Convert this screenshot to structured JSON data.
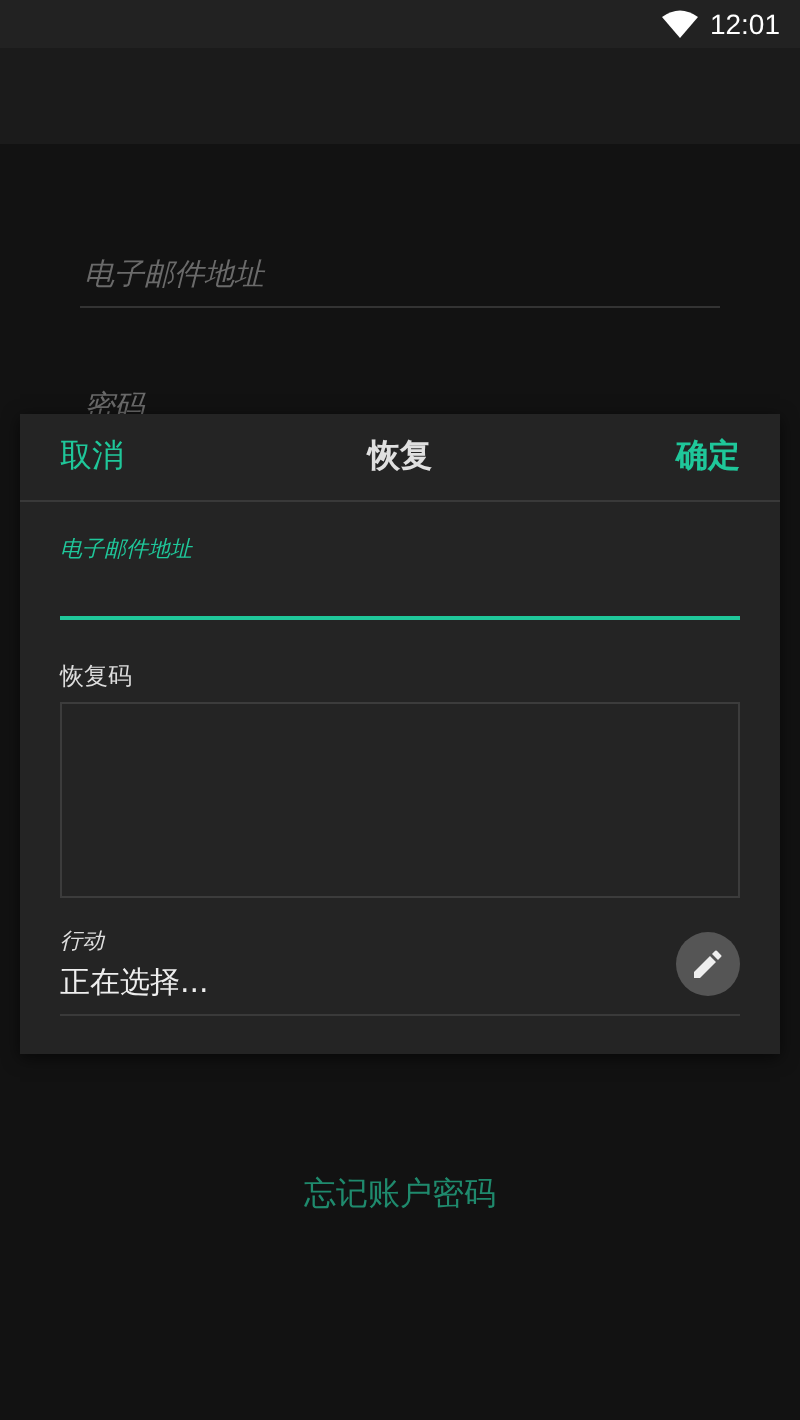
{
  "status_bar": {
    "time": "12:01"
  },
  "login_form": {
    "email": {
      "placeholder": "电子邮件地址"
    },
    "password": {
      "placeholder": "密码"
    },
    "forgot_link": "忘记账户密码"
  },
  "dialog": {
    "cancel": "取消",
    "title": "恢复",
    "confirm": "确定",
    "email": {
      "label": "电子邮件地址",
      "focused": true
    },
    "recovery_code": {
      "label": "恢复码"
    },
    "action": {
      "label": "行动",
      "value": "正在选择..."
    }
  }
}
